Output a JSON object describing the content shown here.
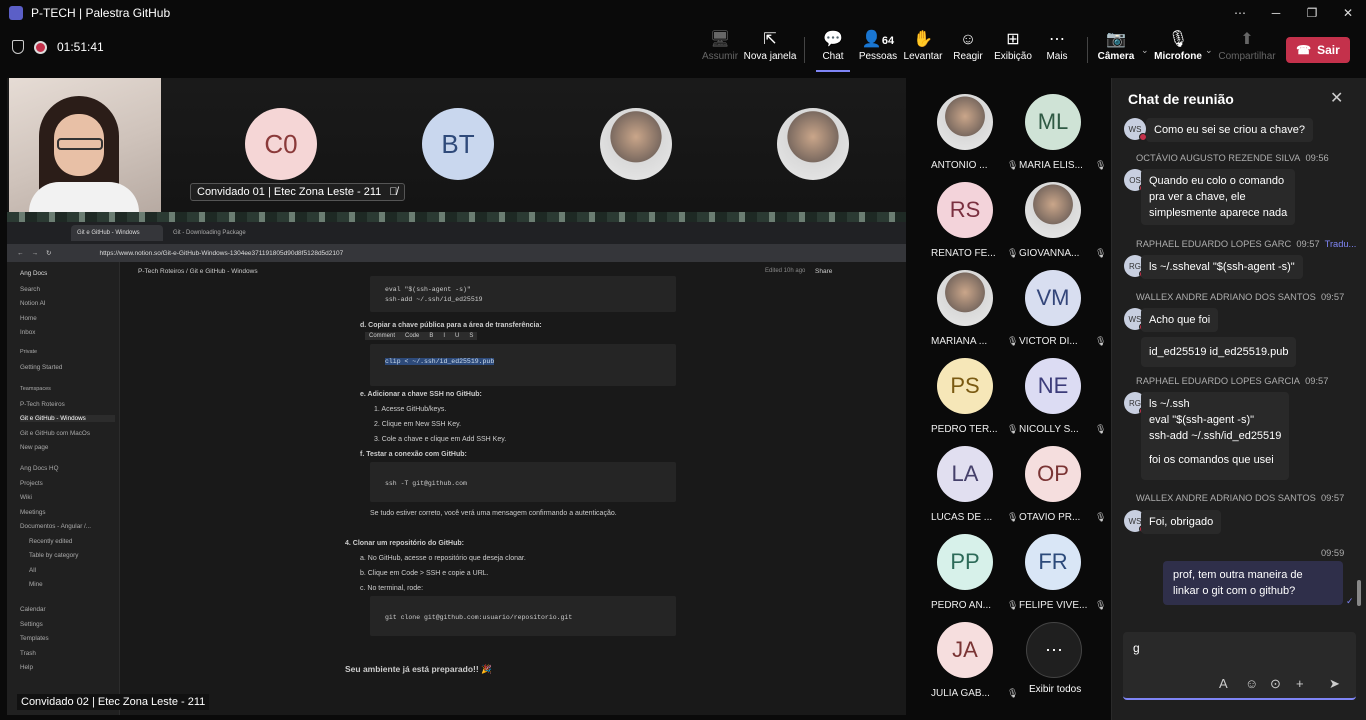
{
  "window": {
    "title": "P-TECH | Palestra GitHub",
    "controls": [
      "⋯",
      "─",
      "❐",
      "✕"
    ]
  },
  "toolbar": {
    "timer": "01:51:41",
    "buttons": [
      {
        "label": "Assumir",
        "icon": "take-control-icon"
      },
      {
        "label": "Nova janela",
        "icon": "pop-out-icon"
      },
      {
        "label": "Chat",
        "icon": "chat-icon"
      },
      {
        "label": "Pessoas",
        "icon": "people-icon",
        "badge": "64"
      },
      {
        "label": "Levantar",
        "icon": "raise-hand-icon"
      },
      {
        "label": "Reagir",
        "icon": "react-icon"
      },
      {
        "label": "Exibição",
        "icon": "view-icon"
      },
      {
        "label": "Mais",
        "icon": "more-icon"
      },
      {
        "label": "Câmera",
        "icon": "camera-off-icon"
      },
      {
        "label": "Microfone",
        "icon": "mic-off-icon"
      },
      {
        "label": "Compartilhar",
        "icon": "share-icon"
      }
    ],
    "leave": "Sair"
  },
  "stage": {
    "tiles": [
      {
        "initials": "C0",
        "bg": "#f5d6d6",
        "fg": "#8a3a3a"
      },
      {
        "initials": "BT",
        "bg": "#c9d7ee",
        "fg": "#2f4a7a"
      }
    ],
    "top_label": "Convidado 01 | Etec Zona Leste - 211",
    "bottom_label": "Convidado 02 | Etec Zona Leste - 211",
    "browser": {
      "tab1": "Git e GitHub - Windows",
      "tab2": "Git - Downloading Package",
      "url": "https://www.notion.so/Git-e-GitHub-Windows-1304ee371191805d90d8f5128d5d2107"
    },
    "notion": {
      "workspace": "Ang Docs",
      "sidebar": [
        "Search",
        "Notion AI",
        "Home",
        "Inbox",
        "Private",
        "Getting Started",
        "Teamspaces",
        "P-Tech Roteiros",
        "Git e GitHub - Windows",
        "Git e GitHub com MacOs",
        "New page",
        "Ang Docs HQ",
        "Projects",
        "Wiki",
        "Meetings",
        "Documentos - Angular /...",
        "Recently edited",
        "Table by category",
        "All",
        "Mine",
        "Calendar",
        "Settings",
        "Templates",
        "Trash",
        "Help"
      ],
      "breadcrumb": "P-Tech Roteiros / Git e GitHub - Windows",
      "edited": "Edited 10h ago",
      "share": "Share",
      "code1": [
        "eval \"$(ssh-agent -s)\"",
        "ssh-add ~/.ssh/id_ed25519"
      ],
      "step_d": "d.  Copiar a chave pública para a área de transferência:",
      "code2": "clip < ~/.ssh/id_ed25519.pub",
      "step_e": "e.  Adicionar a chave SSH no GitHub:",
      "e1": "1.  Acesse GitHub/keys.",
      "e2": "2.  Clique em New SSH Key.",
      "e3": "3.  Cole a chave e clique em Add SSH Key.",
      "step_f": "f.  Testar a conexão com GitHub:",
      "code3": "ssh -T git@github.com",
      "ok_text": "Se tudo estiver correto, você verá uma mensagem confirmando a autenticação.",
      "step4": "4.  Clonar um repositório do GitHub:",
      "a": "a.  No GitHub, acesse o repositório que deseja clonar.",
      "b": "b.  Clique em Code > SSH e copie a URL.",
      "c": "c.  No terminal, rode:",
      "code4": "git clone git@github.com:usuario/repositorio.git",
      "final": "Seu ambiente já está preparado!! 🎉",
      "popup": [
        "Comment",
        "Code",
        "B",
        "I",
        "U",
        "S"
      ]
    }
  },
  "gallery": [
    {
      "name": "ANTONIO ...",
      "initials": "",
      "bg": "#8fa7c9",
      "fg": "#2a3a5a"
    },
    {
      "name": "MARIA ELIS...",
      "initials": "ML",
      "bg": "#cfe3d6",
      "fg": "#2f5a44"
    },
    {
      "name": "RENATO FE...",
      "initials": "RS",
      "bg": "#f3d3da",
      "fg": "#7a3040"
    },
    {
      "name": "GIOVANNA...",
      "initials": "",
      "bg": "#6f5f55",
      "fg": "#fff"
    },
    {
      "name": "MARIANA ...",
      "initials": "",
      "bg": "#caa080",
      "fg": "#fff"
    },
    {
      "name": "VICTOR DI...",
      "initials": "VM",
      "bg": "#d8def0",
      "fg": "#34467a"
    },
    {
      "name": "PEDRO TER...",
      "initials": "PS",
      "bg": "#f6e7b8",
      "fg": "#7a5a12"
    },
    {
      "name": "NICOLLY S...",
      "initials": "NE",
      "bg": "#dcdcf3",
      "fg": "#3c3c7a"
    },
    {
      "name": "LUCAS DE ...",
      "initials": "LA",
      "bg": "#e1dff0",
      "fg": "#45406a"
    },
    {
      "name": "OTAVIO PR...",
      "initials": "OP",
      "bg": "#f5dede",
      "fg": "#7a3434"
    },
    {
      "name": "PEDRO AN...",
      "initials": "PP",
      "bg": "#d7f1ea",
      "fg": "#2c6a58"
    },
    {
      "name": "FELIPE VIVE...",
      "initials": "FR",
      "bg": "#d9e6f6",
      "fg": "#2c4a7a"
    },
    {
      "name": "JULIA GAB...",
      "initials": "JA",
      "bg": "#f6dede",
      "fg": "#7a3434"
    }
  ],
  "show_all": "Exibir todos",
  "chat": {
    "title": "Chat de reunião",
    "m0": {
      "initials": "WS",
      "text": "Como eu sei se criou a chave?"
    },
    "m1": {
      "author": "OCTÁVIO AUGUSTO REZENDE SILVA",
      "time": "09:56",
      "initials": "OS",
      "lines": [
        "Quando eu colo o comando",
        "pra ver a chave, ele",
        "simplesmente aparece nada"
      ]
    },
    "m2": {
      "author": "RAPHAEL EDUARDO LOPES GARC",
      "time": "09:57",
      "translate": "Tradu...",
      "initials": "RG",
      "text": "ls ~/.ssheval \"$(ssh-agent -s)\""
    },
    "m3": {
      "author": "WALLEX ANDRE ADRIANO DOS SANTOS",
      "time": "09:57",
      "initials": "WS",
      "text": "Acho que foi",
      "text2": "id_ed25519  id_ed25519.pub"
    },
    "m4": {
      "author": "RAPHAEL EDUARDO LOPES GARCIA",
      "time": "09:57",
      "initials": "RG",
      "lines": [
        "ls ~/.ssh",
        "eval \"$(ssh-agent -s)\"",
        "ssh-add ~/.ssh/id_ed25519",
        "",
        "foi os comandos que usei"
      ]
    },
    "m5": {
      "author": "WALLEX ANDRE ADRIANO DOS SANTOS",
      "time": "09:57",
      "initials": "WS",
      "text": "Foi, obrigado"
    },
    "own": {
      "time": "09:59",
      "lines": [
        "prof, tem outra maneira de",
        "linkar o git com o github?"
      ]
    },
    "compose_value": "g"
  }
}
